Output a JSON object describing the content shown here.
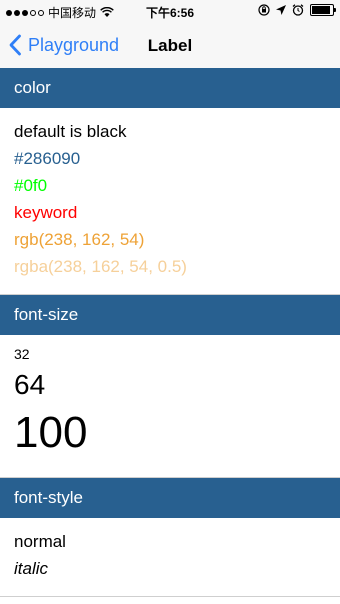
{
  "statusbar": {
    "carrier": "中国移动",
    "time": "下午6:56",
    "signal_bars_filled": 3,
    "signal_bars_total": 5,
    "battery_level": 0.9
  },
  "nav": {
    "back_label": "Playground",
    "title": "Label"
  },
  "sections": {
    "color": {
      "title": "color",
      "items": [
        {
          "text": "default is black",
          "color": "#000000"
        },
        {
          "text": "#286090",
          "color": "#286090"
        },
        {
          "text": "#0f0",
          "color": "#00ff00"
        },
        {
          "text": "keyword",
          "color": "#ff0000"
        },
        {
          "text": "rgb(238, 162, 54)",
          "color": "#eea236"
        },
        {
          "text": "rgba(238, 162, 54, 0.5)",
          "color": "rgba(238,162,54,0.5)"
        }
      ]
    },
    "font_size": {
      "title": "font-size",
      "items": [
        {
          "text": "32"
        },
        {
          "text": "64"
        },
        {
          "text": "100"
        }
      ]
    },
    "font_style": {
      "title": "font-style",
      "items": [
        {
          "text": "normal"
        },
        {
          "text": "italic"
        }
      ]
    }
  },
  "colors": {
    "header_bg": "#286090",
    "accent": "#2f7ff7"
  }
}
